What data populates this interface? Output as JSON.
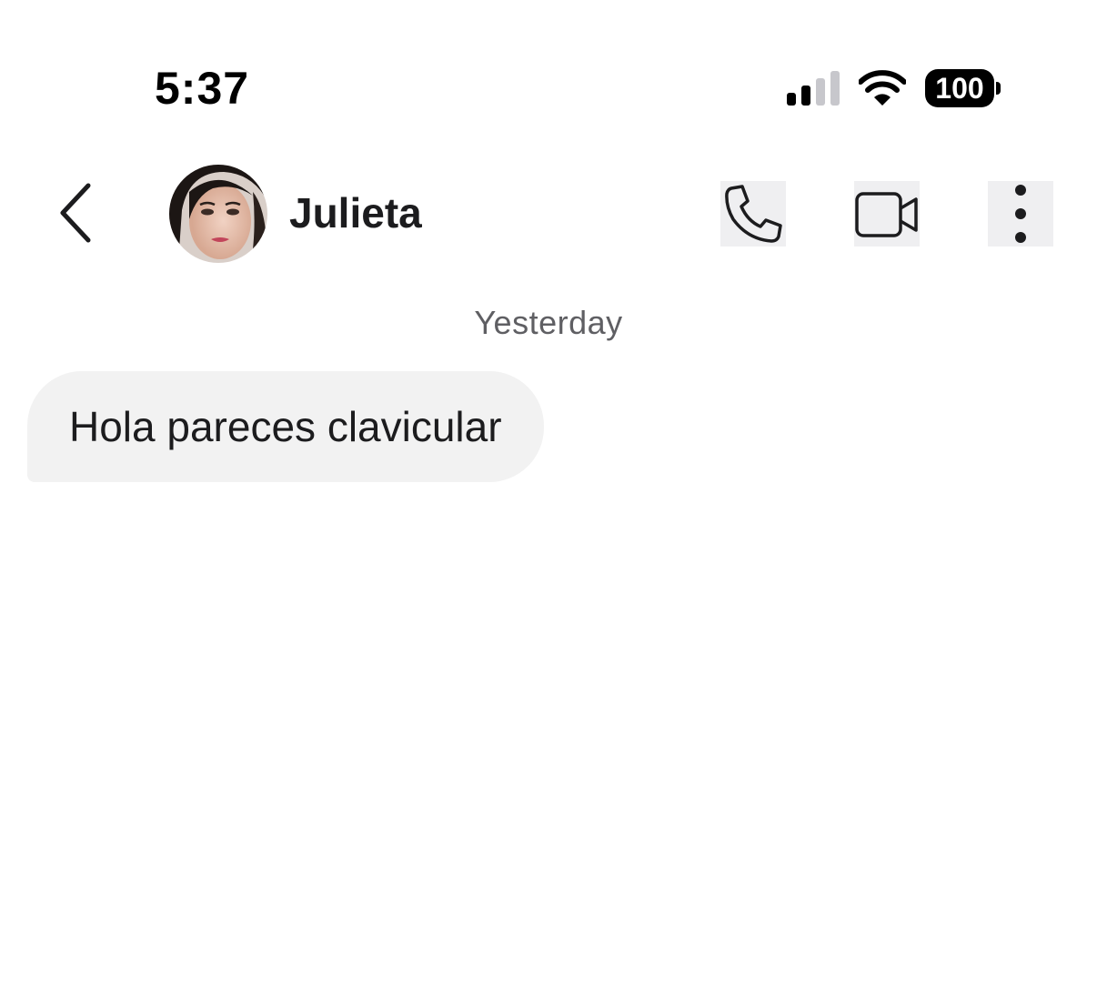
{
  "status_bar": {
    "time": "5:37",
    "battery_level": "100",
    "signal_icon": "cellular-signal-icon",
    "wifi_icon": "wifi-icon",
    "battery_icon": "battery-icon"
  },
  "header": {
    "back_icon": "chevron-left-icon",
    "contact_name": "Julieta",
    "avatar": "contact-avatar-photo",
    "actions": [
      {
        "name": "call",
        "icon": "phone-icon"
      },
      {
        "name": "video",
        "icon": "video-camera-icon"
      },
      {
        "name": "more",
        "icon": "more-vertical-icon"
      }
    ]
  },
  "conversation": {
    "date_separator": "Yesterday",
    "messages": [
      {
        "direction": "incoming",
        "text": "Hola pareces clavicular"
      }
    ]
  },
  "colors": {
    "bubble_incoming": "#f2f2f2",
    "action_button_bg": "#efeff1",
    "text_primary": "#1c1c1e",
    "text_secondary": "#5f5f63"
  }
}
